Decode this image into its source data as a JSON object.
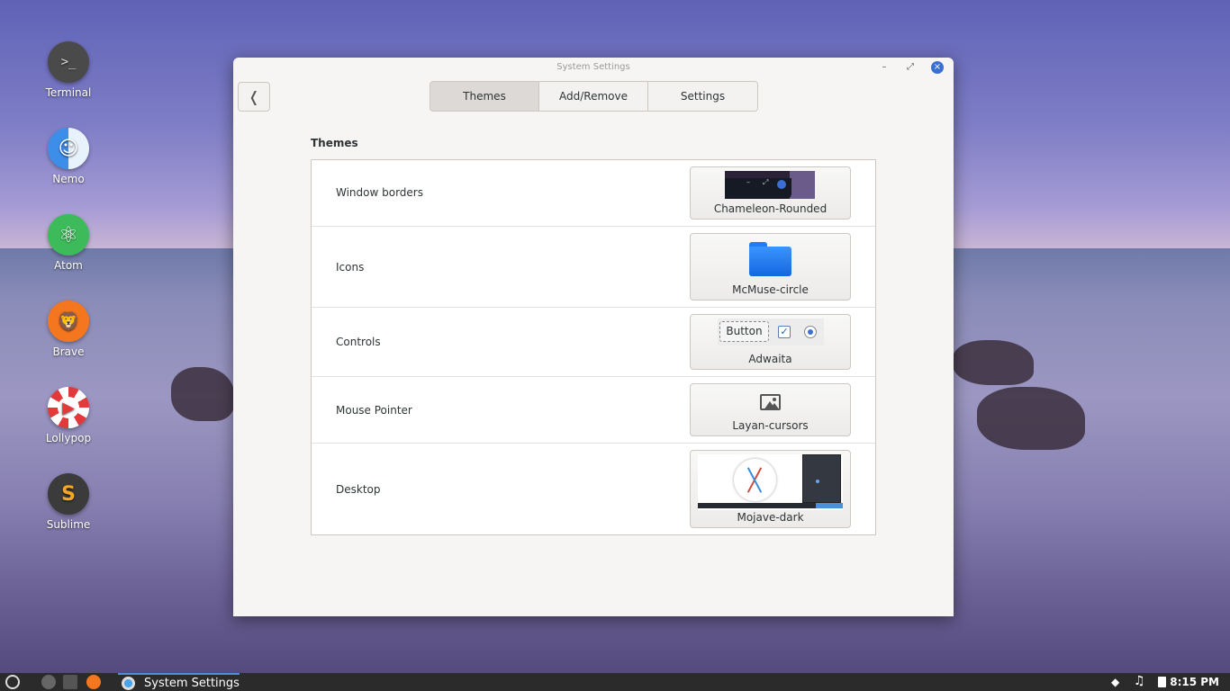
{
  "desktop": {
    "icons": [
      {
        "label": "Terminal",
        "glyph": ">_",
        "color": "#4a4a4a"
      },
      {
        "label": "Nemo",
        "glyph": "☺",
        "color": "#4ea3f2"
      },
      {
        "label": "Atom",
        "glyph": "⚛",
        "color": "#3dbb5a"
      },
      {
        "label": "Brave",
        "glyph": "🦁",
        "color": "#f4771f"
      },
      {
        "label": "Lollypop",
        "glyph": "▶",
        "color": "#e23a3a"
      },
      {
        "label": "Sublime",
        "glyph": "S",
        "color": "#3b3b3b"
      }
    ]
  },
  "window": {
    "title": "System Settings",
    "controls": {
      "minimize": "–",
      "maximize": "⤢",
      "close": "×"
    },
    "back_glyph": "❬",
    "tabs": [
      {
        "label": "Themes",
        "active": true
      },
      {
        "label": "Add/Remove",
        "active": false
      },
      {
        "label": "Settings",
        "active": false
      }
    ],
    "section_title": "Themes",
    "rows": [
      {
        "label": "Window borders",
        "value": "Chameleon-Rounded"
      },
      {
        "label": "Icons",
        "value": "McMuse-circle"
      },
      {
        "label": "Controls",
        "value": "Adwaita",
        "preview_button": "Button"
      },
      {
        "label": "Mouse Pointer",
        "value": "Layan-cursors"
      },
      {
        "label": "Desktop",
        "value": "Mojave-dark"
      }
    ]
  },
  "taskbar": {
    "task_label": "System Settings",
    "clock": "8:15 PM"
  },
  "colors": {
    "accent": "#3b6fd1",
    "folder_blue": "#1e7df5"
  }
}
